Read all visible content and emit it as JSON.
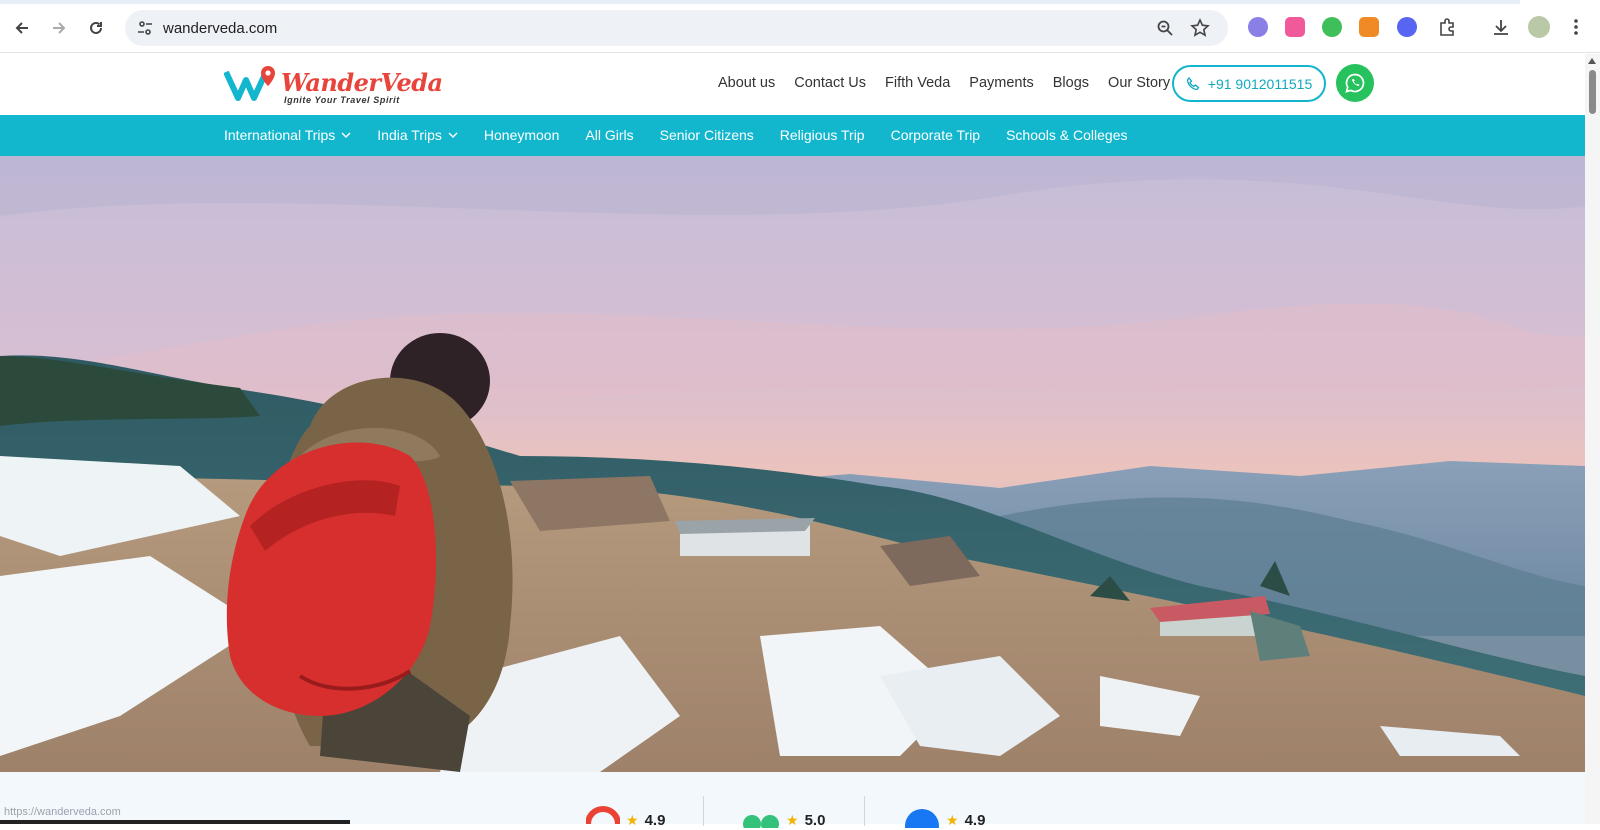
{
  "browser": {
    "url": "wanderveda.com",
    "icons": [
      "back-icon",
      "forward-icon",
      "reload-icon",
      "site-info-icon",
      "zoom-icon",
      "bookmark-star-icon",
      "extensions-icon",
      "download-icon",
      "menu-icon"
    ]
  },
  "site": {
    "brand": "WanderVeda",
    "tagline": "Ignite Your Travel Spirit",
    "top_links": [
      "About us",
      "Contact Us",
      "Fifth Veda",
      "Payments",
      "Blogs",
      "Our Story"
    ],
    "phone": "+91 9012011515",
    "menu": [
      {
        "label": "International Trips",
        "dropdown": true
      },
      {
        "label": "India Trips",
        "dropdown": true
      },
      {
        "label": "Honeymoon",
        "dropdown": false
      },
      {
        "label": "All Girls",
        "dropdown": false
      },
      {
        "label": "Senior Citizens",
        "dropdown": false
      },
      {
        "label": "Religious Trip",
        "dropdown": false
      },
      {
        "label": "Corporate Trip",
        "dropdown": false
      },
      {
        "label": "Schools & Colleges",
        "dropdown": false
      }
    ],
    "ratings": [
      {
        "source": "google-icon",
        "value": "4.9"
      },
      {
        "source": "tripadvisor-icon",
        "value": "5.0"
      },
      {
        "source": "facebook-icon",
        "value": "4.9"
      }
    ],
    "status_url": "https://wanderveda.com"
  },
  "colors": {
    "accent": "#12b7cd",
    "brand_red": "#e7453b",
    "whatsapp": "#25c25d"
  }
}
